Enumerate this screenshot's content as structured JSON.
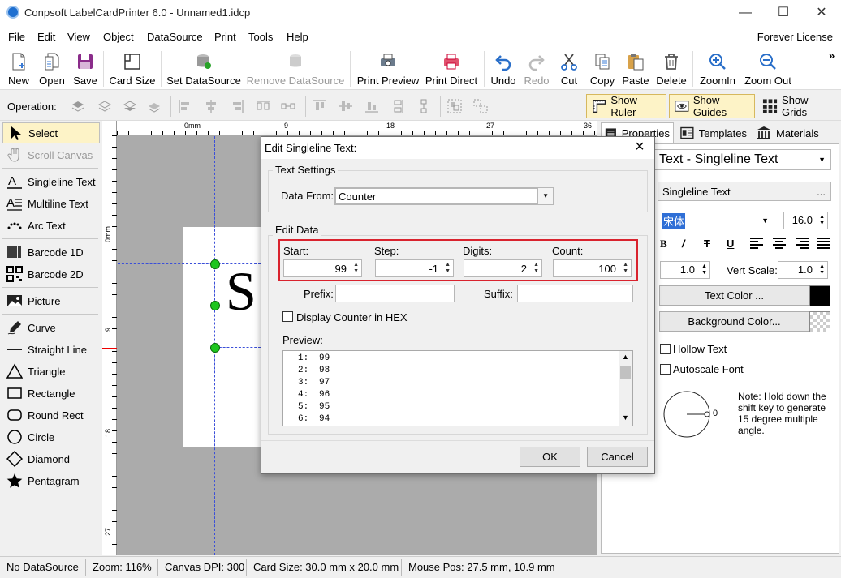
{
  "app": {
    "title": "Conpsoft LabelCardPrinter 6.0 - Unnamed1.idcp",
    "license": "Forever License"
  },
  "menu": [
    "File",
    "Edit",
    "View",
    "Object",
    "DataSource",
    "Print",
    "Tools",
    "Help"
  ],
  "toolbar": {
    "new": "New",
    "open": "Open",
    "save": "Save",
    "card_size": "Card Size",
    "set_datasource": "Set DataSource",
    "remove_datasource": "Remove DataSource",
    "print_preview": "Print Preview",
    "print_direct": "Print Direct",
    "undo": "Undo",
    "redo": "Redo",
    "cut": "Cut",
    "copy": "Copy",
    "paste": "Paste",
    "delete": "Delete",
    "zoom_in": "ZoomIn",
    "zoom_out": "Zoom Out",
    "more": "»"
  },
  "operation": {
    "label": "Operation:",
    "show_ruler": "Show Ruler",
    "show_guides": "Show Guides",
    "show_grids": "Show Grids"
  },
  "palette": {
    "select": "Select",
    "scroll_canvas": "Scroll Canvas",
    "singleline_text": "Singleline Text",
    "multiline_text": "Multiline Text",
    "arc_text": "Arc Text",
    "barcode_1d": "Barcode 1D",
    "barcode_2d": "Barcode 2D",
    "picture": "Picture",
    "curve": "Curve",
    "straight_line": "Straight Line",
    "triangle": "Triangle",
    "rectangle": "Rectangle",
    "round_rect": "Round Rect",
    "circle": "Circle",
    "diamond": "Diamond",
    "pentagram": "Pentagram"
  },
  "ruler": {
    "h": [
      "0mm",
      "9",
      "18",
      "27",
      "36"
    ],
    "v": [
      "0mm",
      "9",
      "18",
      "27"
    ]
  },
  "canvas": {
    "letter": "S"
  },
  "right_panel": {
    "tabs": {
      "properties": "Properties",
      "templates": "Templates",
      "materials": "Materials"
    },
    "object_type": "Text - Singleline Text",
    "text_value": "Singleline Text",
    "ellipsis": "...",
    "font_name": "宋体",
    "font_size": "16.0",
    "hor_scale": "1.0",
    "vert_scale_label": "Vert Scale:",
    "vert_scale": "1.0",
    "text_color": "Text Color ...",
    "background_color": "Background Color...",
    "hollow_text": "Hollow Text",
    "autoscale_font": "Autoscale Font",
    "angle": "0",
    "note": "Note: Hold down the shift key to generate 15 degree multiple angle.",
    "text_color_hex": "#000000"
  },
  "dialog": {
    "title": "Edit Singleline Text:",
    "text_settings": "Text Settings",
    "data_from_label": "Data From:",
    "data_from": "Counter",
    "edit_data": "Edit Data",
    "start_label": "Start:",
    "start": "99",
    "step_label": "Step:",
    "step": "-1",
    "digits_label": "Digits:",
    "digits": "2",
    "count_label": "Count:",
    "count": "100",
    "prefix_label": "Prefix:",
    "suffix_label": "Suffix:",
    "prefix": "",
    "suffix": "",
    "hex_label": "Display Counter in HEX",
    "preview_label": "Preview:",
    "preview": [
      {
        "n": "1:",
        "v": "99"
      },
      {
        "n": "2:",
        "v": "98"
      },
      {
        "n": "3:",
        "v": "97"
      },
      {
        "n": "4:",
        "v": "96"
      },
      {
        "n": "5:",
        "v": "95"
      },
      {
        "n": "6:",
        "v": "94"
      }
    ],
    "ok": "OK",
    "cancel": "Cancel",
    "highlight_color": "#d9232e"
  },
  "status": {
    "datasource": "No DataSource",
    "zoom": "Zoom: 116%",
    "dpi": "Canvas DPI: 300",
    "card_size": "Card Size: 30.0 mm x 20.0 mm",
    "mouse_pos": "Mouse Pos: 27.5 mm, 10.9 mm"
  }
}
